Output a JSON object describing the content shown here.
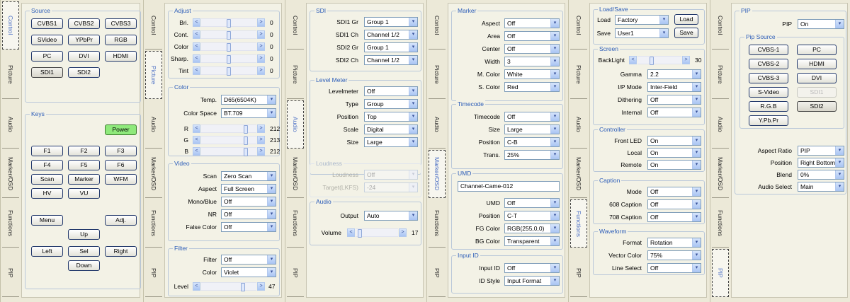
{
  "tabs": [
    "Control",
    "Picture",
    "Audio",
    "Marker/OSD",
    "Functions",
    "PIP"
  ],
  "arrows": {
    "left": "<",
    "right": ">",
    "down": "▾"
  },
  "control": {
    "source": {
      "title": "Source",
      "buttons": [
        "CVBS1",
        "CVBS2",
        "CVBS3",
        "SVideo",
        "YPbPr",
        "RGB",
        "PC",
        "DVI",
        "HDMI",
        "SDI1",
        "SDI2"
      ]
    },
    "keys": {
      "title": "Keys",
      "power": "Power",
      "fkeys": [
        "F1",
        "F2",
        "F3",
        "F4",
        "F5",
        "F6"
      ],
      "scan": "Scan",
      "marker": "Marker",
      "wfm": "WFM",
      "hv": "HV",
      "vu": "VU",
      "menu": "Menu",
      "adj": "Adj.",
      "up": "Up",
      "left": "Left",
      "sel": "Sel",
      "right": "Right",
      "down": "Down"
    }
  },
  "picture": {
    "adjust": {
      "title": "Adjust",
      "rows": [
        {
          "label": "Bri.",
          "value": "0",
          "level": 0.5
        },
        {
          "label": "Cont.",
          "value": "0",
          "level": 0.5
        },
        {
          "label": "Color",
          "value": "0",
          "level": 0.5
        },
        {
          "label": "Sharp.",
          "value": "0",
          "level": 0.5
        },
        {
          "label": "Tint",
          "value": "0",
          "level": 0.5
        }
      ]
    },
    "color": {
      "title": "Color",
      "temp_label": "Temp.",
      "temp_value": "D65(6504K)",
      "space_label": "Color Space",
      "space_value": "BT.709",
      "rgb": [
        {
          "label": "R",
          "value": "212",
          "level": 0.83
        },
        {
          "label": "G",
          "value": "213",
          "level": 0.84
        },
        {
          "label": "B",
          "value": "212",
          "level": 0.83
        }
      ]
    },
    "video": {
      "title": "Video",
      "rows": [
        {
          "label": "Scan",
          "value": "Zero Scan"
        },
        {
          "label": "Aspect",
          "value": "Full Screen"
        },
        {
          "label": "Mono/Blue",
          "value": "Off"
        },
        {
          "label": "NR",
          "value": "Off"
        },
        {
          "label": "False Color",
          "value": "Off"
        }
      ]
    },
    "filter": {
      "title": "Filter",
      "filter_label": "Filter",
      "filter_value": "Off",
      "color_label": "Color",
      "color_value": "Violet",
      "level_label": "Level",
      "level_value": "47",
      "level": 0.78
    }
  },
  "audio": {
    "sdi": {
      "title": "SDI",
      "rows": [
        {
          "label": "SDI1 Gr",
          "value": "Group 1"
        },
        {
          "label": "SDI1 Ch",
          "value": "Channel 1/2"
        },
        {
          "label": "SDI2 Gr",
          "value": "Group 1"
        },
        {
          "label": "SDI2 Ch",
          "value": "Channel 1/2"
        }
      ]
    },
    "level_meter": {
      "title": "Level Meter",
      "rows": [
        {
          "label": "Levelmeter",
          "value": "Off"
        },
        {
          "label": "Type",
          "value": "Group"
        },
        {
          "label": "Position",
          "value": "Top"
        },
        {
          "label": "Scale",
          "value": "Digital"
        },
        {
          "label": "Size",
          "value": "Large"
        }
      ]
    },
    "loudness": {
      "title": "Loudness",
      "rows": [
        {
          "label": "Loudness",
          "value": "Off"
        },
        {
          "label": "Target(LKFS)",
          "value": "-24"
        }
      ]
    },
    "audio_group": {
      "title": "Audio",
      "output_label": "Output",
      "output_value": "Auto",
      "volume_label": "Volume",
      "volume_value": "17",
      "volume_level": 0.05
    }
  },
  "marker_osd": {
    "marker": {
      "title": "Marker",
      "rows": [
        {
          "label": "Aspect",
          "value": "Off"
        },
        {
          "label": "Area",
          "value": "Off"
        },
        {
          "label": "Center",
          "value": "Off"
        },
        {
          "label": "Width",
          "value": "3"
        },
        {
          "label": "M. Color",
          "value": "White"
        },
        {
          "label": "S. Color",
          "value": "Red"
        }
      ]
    },
    "timecode": {
      "title": "Timecode",
      "rows": [
        {
          "label": "Timecode",
          "value": "Off"
        },
        {
          "label": "Size",
          "value": "Large"
        },
        {
          "label": "Position",
          "value": "C-B"
        },
        {
          "label": "Trans.",
          "value": "25%"
        }
      ]
    },
    "umd": {
      "title": "UMD",
      "text": "Channel-Came-012",
      "rows": [
        {
          "label": "UMD",
          "value": "Off"
        },
        {
          "label": "Position",
          "value": "C-T"
        },
        {
          "label": "FG Color",
          "value": "RGB(255,0,0)"
        },
        {
          "label": "BG Color",
          "value": "Transparent"
        }
      ]
    },
    "input_id": {
      "title": "Input ID",
      "rows": [
        {
          "label": "Input ID",
          "value": "Off"
        },
        {
          "label": "ID Style",
          "value": "Input Format"
        }
      ]
    }
  },
  "functions": {
    "load_save": {
      "title": "Load/Save",
      "load_label": "Load",
      "load_value": "Factory",
      "load_btn": "Load",
      "save_label": "Save",
      "save_value": "User1",
      "save_btn": "Save"
    },
    "screen": {
      "title": "Screen",
      "backlight_label": "BackLight",
      "backlight_value": "30",
      "backlight_level": 0.3,
      "rows": [
        {
          "label": "Gamma",
          "value": "2.2"
        },
        {
          "label": "I/P Mode",
          "value": "Inter-Field"
        },
        {
          "label": "Dithering",
          "value": "Off"
        },
        {
          "label": "Internal",
          "value": "Off"
        }
      ]
    },
    "controller": {
      "title": "Controller",
      "rows": [
        {
          "label": "Front LED",
          "value": "On"
        },
        {
          "label": "Local",
          "value": "On"
        },
        {
          "label": "Remote",
          "value": "On"
        }
      ]
    },
    "caption": {
      "title": "Caption",
      "rows": [
        {
          "label": "Mode",
          "value": "Off"
        },
        {
          "label": "608 Caption",
          "value": "Off"
        },
        {
          "label": "708 Caption",
          "value": "Off"
        }
      ]
    },
    "waveform": {
      "title": "Waveform",
      "rows": [
        {
          "label": "Format",
          "value": "Rotation"
        },
        {
          "label": "Vector Color",
          "value": "75%"
        },
        {
          "label": "Line Select",
          "value": "Off"
        }
      ]
    }
  },
  "pip": {
    "title": "PIP",
    "pip_label": "PIP",
    "pip_value": "On",
    "source_title": "Pip Source",
    "source_buttons": [
      "CVBS-1",
      "PC",
      "CVBS-2",
      "HDMI",
      "CVBS-3",
      "DVI",
      "S-Video",
      "SDI1",
      "R.G.B",
      "SDI2",
      "Y.Pb.Pr"
    ],
    "rows": [
      {
        "label": "Aspect Ratio",
        "value": "PIP"
      },
      {
        "label": "Position",
        "value": "Right Bottom"
      },
      {
        "label": "Blend",
        "value": "0%"
      },
      {
        "label": "Audio Select",
        "value": "Main"
      }
    ]
  }
}
